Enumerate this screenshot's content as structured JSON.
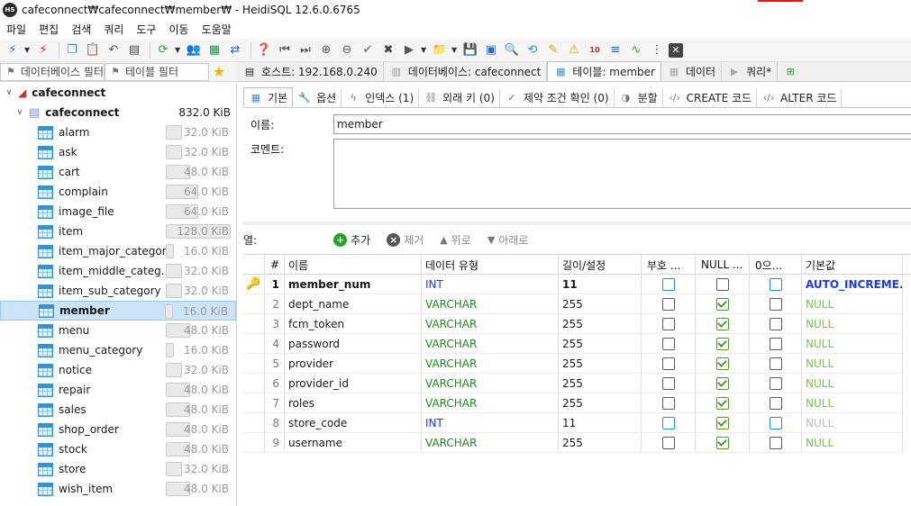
{
  "window": {
    "title": "cafeconnect₩cafeconnect₩member₩ - HeidiSQL 12.6.0.6765",
    "app_icon_text": "HS"
  },
  "menu": [
    "파일",
    "편집",
    "검색",
    "쿼리",
    "도구",
    "이동",
    "도움말"
  ],
  "filters": {
    "db_filter": "데이터베이스 필터",
    "table_filter": "테이블 필터"
  },
  "main_tabs": [
    {
      "label": "호스트: 192.168.0.240",
      "icon": "host-icon"
    },
    {
      "label": "데이터베이스: cafeconnect",
      "icon": "database-icon"
    },
    {
      "label": "테이블: member",
      "icon": "table-icon"
    },
    {
      "label": "데이터",
      "icon": "data-grid-icon"
    },
    {
      "label": "쿼리*",
      "icon": "play-icon"
    }
  ],
  "tree": {
    "root": "cafeconnect",
    "database": {
      "name": "cafeconnect",
      "size": "832.0 KiB"
    },
    "tables": [
      {
        "name": "alarm",
        "size": "32.0 KiB",
        "fill": 0.25
      },
      {
        "name": "ask",
        "size": "32.0 KiB",
        "fill": 0.25
      },
      {
        "name": "cart",
        "size": "48.0 KiB",
        "fill": 0.375
      },
      {
        "name": "complain",
        "size": "64.0 KiB",
        "fill": 0.5
      },
      {
        "name": "image_file",
        "size": "64.0 KiB",
        "fill": 0.5
      },
      {
        "name": "item",
        "size": "128.0 KiB",
        "fill": 1.0
      },
      {
        "name": "item_major_category",
        "size": "16.0 KiB",
        "fill": 0.125
      },
      {
        "name": "item_middle_categ...",
        "size": "32.0 KiB",
        "fill": 0.25
      },
      {
        "name": "item_sub_category",
        "size": "32.0 KiB",
        "fill": 0.25
      },
      {
        "name": "member",
        "size": "16.0 KiB",
        "fill": 0.125
      },
      {
        "name": "menu",
        "size": "48.0 KiB",
        "fill": 0.375
      },
      {
        "name": "menu_category",
        "size": "16.0 KiB",
        "fill": 0.125
      },
      {
        "name": "notice",
        "size": "32.0 KiB",
        "fill": 0.25
      },
      {
        "name": "repair",
        "size": "48.0 KiB",
        "fill": 0.375
      },
      {
        "name": "sales",
        "size": "48.0 KiB",
        "fill": 0.375
      },
      {
        "name": "shop_order",
        "size": "48.0 KiB",
        "fill": 0.375
      },
      {
        "name": "stock",
        "size": "48.0 KiB",
        "fill": 0.375
      },
      {
        "name": "store",
        "size": "32.0 KiB",
        "fill": 0.25
      },
      {
        "name": "wish_item",
        "size": "48.0 KiB",
        "fill": 0.375
      }
    ],
    "selected": "member"
  },
  "sub_tabs": [
    {
      "label": "기본",
      "icon": "table-icon"
    },
    {
      "label": "옵션",
      "icon": "wrench-icon"
    },
    {
      "label": "인덱스 (1)",
      "icon": "lightning-icon"
    },
    {
      "label": "외래 키 (0)",
      "icon": "foreign-key-icon"
    },
    {
      "label": "제약 조건 확인 (0)",
      "icon": "check-icon"
    },
    {
      "label": "분할",
      "icon": "partition-icon"
    },
    {
      "label": "CREATE 코드",
      "icon": "code-icon"
    },
    {
      "label": "ALTER 코드",
      "icon": "code-icon"
    }
  ],
  "form": {
    "name_label": "이름:",
    "name_value": "member",
    "comment_label": "코멘트:"
  },
  "columns_toolbar": {
    "label": "열:",
    "add": "추가",
    "remove": "제거",
    "up": "위로",
    "down": "아래로"
  },
  "grid": {
    "headers": [
      "#",
      "이름",
      "데이터 유형",
      "길이/설정",
      "부호 ...",
      "NULL ...",
      "0으...",
      "기본값"
    ],
    "rows": [
      {
        "num": "1",
        "name": "member_num",
        "type": "INT",
        "length": "11",
        "unsigned": false,
        "allow_null": false,
        "zerofill": false,
        "default": "AUTO_INCREME...",
        "primary": true
      },
      {
        "num": "2",
        "name": "dept_name",
        "type": "VARCHAR",
        "length": "255",
        "unsigned": false,
        "allow_null": true,
        "zerofill": false,
        "default": "NULL",
        "primary": false
      },
      {
        "num": "3",
        "name": "fcm_token",
        "type": "VARCHAR",
        "length": "255",
        "unsigned": false,
        "allow_null": true,
        "zerofill": false,
        "default": "NULL",
        "primary": false
      },
      {
        "num": "4",
        "name": "password",
        "type": "VARCHAR",
        "length": "255",
        "unsigned": false,
        "allow_null": true,
        "zerofill": false,
        "default": "NULL",
        "primary": false
      },
      {
        "num": "5",
        "name": "provider",
        "type": "VARCHAR",
        "length": "255",
        "unsigned": false,
        "allow_null": true,
        "zerofill": false,
        "default": "NULL",
        "primary": false
      },
      {
        "num": "6",
        "name": "provider_id",
        "type": "VARCHAR",
        "length": "255",
        "unsigned": false,
        "allow_null": true,
        "zerofill": false,
        "default": "NULL",
        "primary": false
      },
      {
        "num": "7",
        "name": "roles",
        "type": "VARCHAR",
        "length": "255",
        "unsigned": false,
        "allow_null": true,
        "zerofill": false,
        "default": "NULL",
        "primary": false
      },
      {
        "num": "8",
        "name": "store_code",
        "type": "INT",
        "length": "11",
        "unsigned": false,
        "allow_null": true,
        "zerofill": false,
        "default": "NULL",
        "primary": false
      },
      {
        "num": "9",
        "name": "username",
        "type": "VARCHAR",
        "length": "255",
        "unsigned": false,
        "allow_null": true,
        "zerofill": false,
        "default": "NULL",
        "primary": false
      }
    ]
  },
  "colors": {
    "varchar": "#1e8c1e",
    "int": "#1a3ce0",
    "selection": "#cce4f7",
    "check_green": "#4f9a2f",
    "check_blue": "#1e90e6"
  }
}
